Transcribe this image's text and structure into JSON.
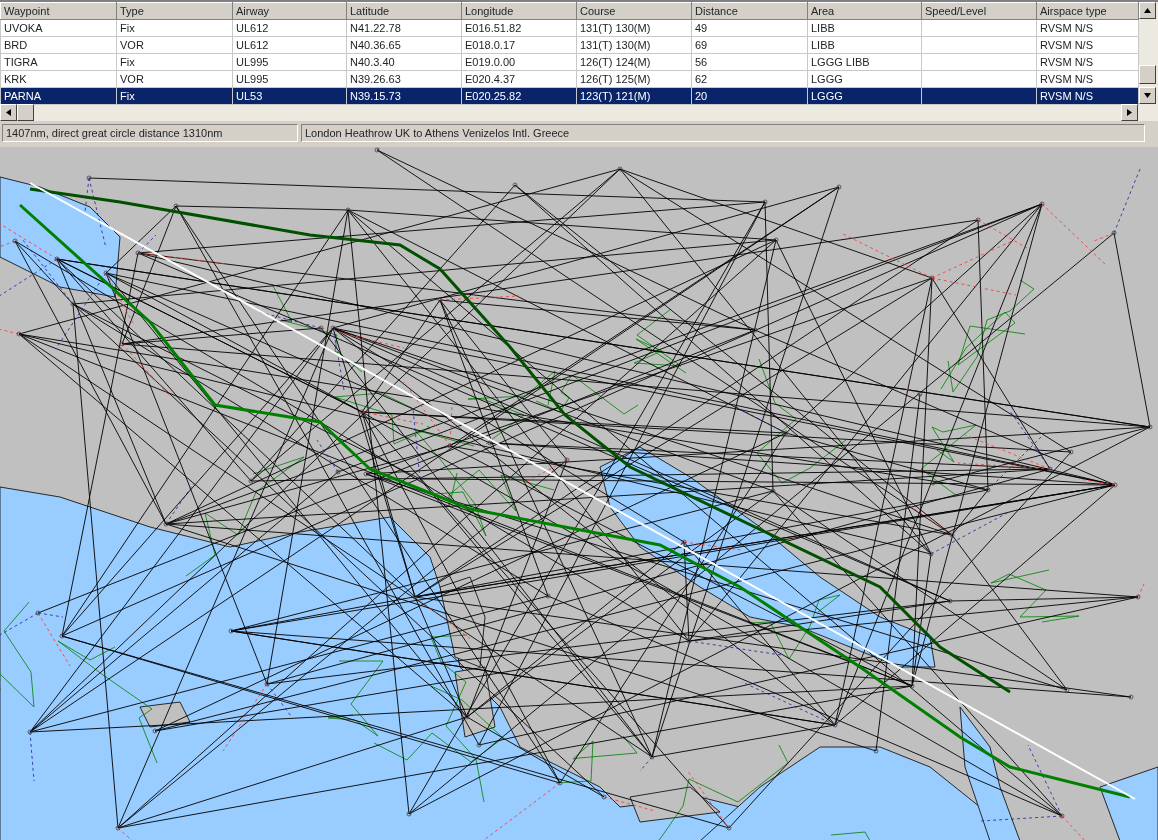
{
  "table": {
    "columns": [
      "Waypoint",
      "Type",
      "Airway",
      "Latitude",
      "Longitude",
      "Course",
      "Distance",
      "Area",
      "Speed/Level",
      "Airspace type"
    ],
    "rows": [
      {
        "cells": [
          "UVOKA",
          "Fix",
          "UL612",
          "N41.22.78",
          "E016.51.82",
          "131(T) 130(M)",
          "49",
          "LIBB",
          "",
          "RVSM N/S"
        ],
        "selected": false
      },
      {
        "cells": [
          "BRD",
          "VOR",
          "UL612",
          "N40.36.65",
          "E018.0.17",
          "131(T) 130(M)",
          "69",
          "LIBB",
          "",
          "RVSM N/S"
        ],
        "selected": false
      },
      {
        "cells": [
          "TIGRA",
          "Fix",
          "UL995",
          "N40.3.40",
          "E019.0.00",
          "126(T) 124(M)",
          "56",
          "LGGG LIBB",
          "",
          "RVSM N/S"
        ],
        "selected": false
      },
      {
        "cells": [
          "KRK",
          "VOR",
          "UL995",
          "N39.26.63",
          "E020.4.37",
          "126(T) 125(M)",
          "62",
          "LGGG",
          "",
          "RVSM N/S"
        ],
        "selected": false
      },
      {
        "cells": [
          "PARNA",
          "Fix",
          "UL53",
          "N39.15.73",
          "E020.25.82",
          "123(T) 121(M)",
          "20",
          "LGGG",
          "",
          "RVSM N/S"
        ],
        "selected": true
      }
    ]
  },
  "status_bar": [
    "1407nm, direct great circle distance 1310nm",
    "London Heathrow UK to Athens Venizelos Intl. Greece"
  ]
}
